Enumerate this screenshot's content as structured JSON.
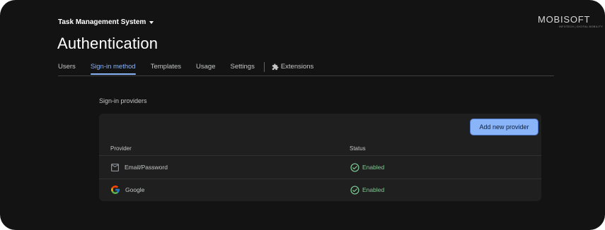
{
  "header": {
    "project_name": "Task Management System",
    "page_title": "Authentication"
  },
  "logo": {
    "text": "MOBISOFT",
    "subtext": "INFOTECH | DIGITAL MOBILITY"
  },
  "tabs": [
    {
      "label": "Users",
      "active": false
    },
    {
      "label": "Sign-in method",
      "active": true
    },
    {
      "label": "Templates",
      "active": false
    },
    {
      "label": "Usage",
      "active": false
    },
    {
      "label": "Settings",
      "active": false
    },
    {
      "label": "Extensions",
      "active": false,
      "icon": "extension-icon"
    }
  ],
  "providers_section": {
    "title": "Sign-in providers",
    "add_button_label": "Add new provider",
    "columns": {
      "provider": "Provider",
      "status": "Status"
    },
    "rows": [
      {
        "provider": "Email/Password",
        "icon": "email-icon",
        "status": "Enabled",
        "status_icon": "check-circle-icon"
      },
      {
        "provider": "Google",
        "icon": "google-icon",
        "status": "Enabled",
        "status_icon": "check-circle-icon"
      }
    ]
  },
  "colors": {
    "background": "#131313",
    "accent": "#8ab4f8",
    "enabled": "#81c995",
    "card": "#1f1f1f"
  }
}
